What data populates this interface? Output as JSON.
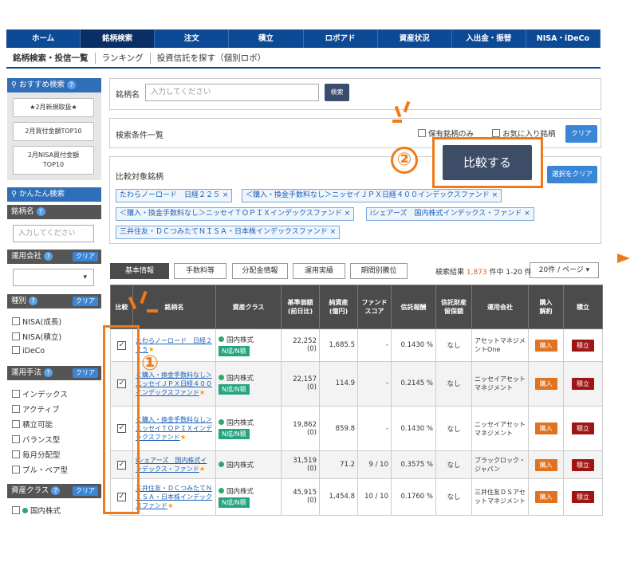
{
  "nav": [
    "ホーム",
    "銘柄検索",
    "注文",
    "積立",
    "ロボアド",
    "資産状況",
    "入出金・振替",
    "NISA・iDeCo"
  ],
  "subnav": [
    "銘柄検索・投信一覧",
    "ランキング",
    "投資信託を探す（個別ロボ）"
  ],
  "sidebar": {
    "recommend_title": "おすすめ検索",
    "recommend": [
      "★2月新規取扱★",
      "2月買付金額TOP10",
      "2月NISA買付金額TOP10"
    ],
    "easy_title": "かんたん検索",
    "name_label": "銘柄名",
    "name_placeholder": "入力してください",
    "company_label": "運用会社",
    "type_label": "種別",
    "type_items": [
      "NISA(成長)",
      "NISA(積立)",
      "iDeCo"
    ],
    "method_label": "運用手法",
    "method_items": [
      "インデックス",
      "アクティブ",
      "積立可能",
      "バランス型",
      "毎月分配型",
      "ブル・ベア型"
    ],
    "asset_label": "資産クラス",
    "asset_items": [
      "国内株式"
    ],
    "clear": "クリア"
  },
  "search": {
    "label": "銘柄名",
    "placeholder": "入力してください",
    "button": "検索"
  },
  "conditions": {
    "label": "検索条件一覧",
    "held": "保有銘柄のみ",
    "favorite": "お気に入り銘柄",
    "clear": "クリア"
  },
  "compare": {
    "label": "比較対象銘柄",
    "button": "比較する",
    "clear_selection": "選択をクリア",
    "tags": [
      "たわらノーロード　日経２２５ ×",
      "＜購入・換金手数料なし＞ニッセイＪＰＸ日経４００インデックスファンド ×",
      "＜購入・換金手数料なし＞ニッセイＴＯＰＩＸインデックスファンド ×",
      "iシェアーズ　国内株式インデックス・ファンド ×",
      "三井住友・ＤＣつみたてＮＩＳＡ・日本株インデックスファンド ×"
    ]
  },
  "tabs": [
    "基本情報",
    "手数料等",
    "分配金情報",
    "運用実績",
    "期間別騰位"
  ],
  "results": {
    "prefix": "検索結果",
    "count": "1,873",
    "suffix": "件中 1-20 件",
    "per_page": "20件 / ページ ▾"
  },
  "columns": [
    "比較",
    "銘柄名",
    "資産クラス",
    "基準価額\n(前日比)",
    "純資産\n(億円)",
    "ファンド\nスコア",
    "信託報酬",
    "信託財産\n留保額",
    "運用会社",
    "購入\n解約",
    "積立"
  ],
  "rows": [
    {
      "name": "たわらノーロード　日経２２５",
      "asset": "国内株式",
      "badge": "N成/N積",
      "price": "22,252",
      "chg": "(0)",
      "nav": "1,685.5",
      "score": "-",
      "fee": "0.1430 %",
      "reserve": "なし",
      "company": "アセットマネジメントOne"
    },
    {
      "name": "＜購入・換金手数料なし＞ニッセイＪＰＸ日経４００インデックスファンド",
      "asset": "国内株式",
      "badge": "N成/N積",
      "price": "22,157",
      "chg": "(0)",
      "nav": "114.9",
      "score": "-",
      "fee": "0.2145 %",
      "reserve": "なし",
      "company": "ニッセイアセットマネジメント"
    },
    {
      "name": "＜購入・換金手数料なし＞ニッセイＴＯＰＩＸインデックスファンド",
      "asset": "国内株式",
      "badge": "N成/N積",
      "price": "19,862",
      "chg": "(0)",
      "nav": "859.8",
      "score": "-",
      "fee": "0.1430 %",
      "reserve": "なし",
      "company": "ニッセイアセットマネジメント"
    },
    {
      "name": "iシェアーズ　国内株式インデックス・ファンド",
      "asset": "国内株式",
      "badge": "",
      "price": "31,519",
      "chg": "(0)",
      "nav": "71.2",
      "score": "9 / 10",
      "fee": "0.3575 %",
      "reserve": "なし",
      "company": "ブラックロック・ジャパン"
    },
    {
      "name": "三井住友・ＤＣつみたてＮＩＳＡ・日本株インデックスファンド",
      "asset": "国内株式",
      "badge": "N成/N積",
      "price": "45,915",
      "chg": "(0)",
      "nav": "1,454.8",
      "score": "10 / 10",
      "fee": "0.1760 %",
      "reserve": "なし",
      "company": "三井住友ＤＳアセットマネジメント"
    }
  ],
  "buy": "購入",
  "tsumitate": "積立",
  "callouts": {
    "one": "①",
    "two": "②"
  }
}
